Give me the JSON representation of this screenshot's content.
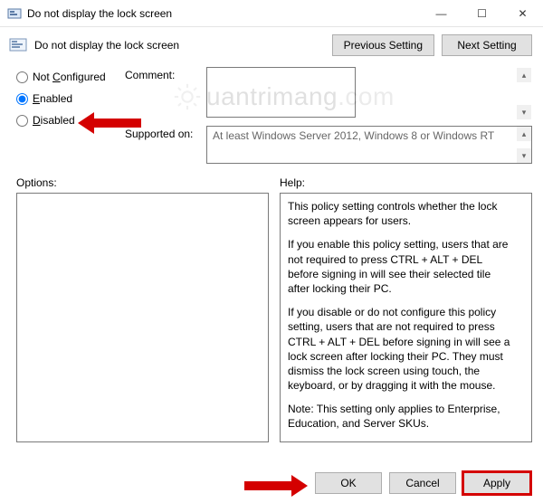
{
  "window": {
    "title": "Do not display the lock screen"
  },
  "header": {
    "policy_title": "Do not display the lock screen",
    "prev_btn": "Previous Setting",
    "next_btn": "Next Setting"
  },
  "radios": {
    "not_configured": "Not Configured",
    "enabled": "Enabled",
    "disabled": "Disabled",
    "selected": "enabled"
  },
  "fields": {
    "comment_label": "Comment:",
    "comment_value": "",
    "supported_label": "Supported on:",
    "supported_value": "At least Windows Server 2012, Windows 8 or Windows RT"
  },
  "mid": {
    "options_label": "Options:",
    "help_label": "Help:",
    "help_paras": [
      "This policy setting controls whether the lock screen appears for users.",
      "If you enable this policy setting, users that are not required to press CTRL + ALT + DEL before signing in will see their selected tile after locking their PC.",
      "If you disable or do not configure this policy setting, users that are not required to press CTRL + ALT + DEL before signing in will see a lock screen after locking their PC. They must dismiss the lock screen using touch, the keyboard, or by dragging it with the mouse.",
      "Note: This setting only applies to Enterprise, Education, and Server SKUs."
    ]
  },
  "buttons": {
    "ok": "OK",
    "cancel": "Cancel",
    "apply": "Apply"
  },
  "watermark": "uantrimang"
}
